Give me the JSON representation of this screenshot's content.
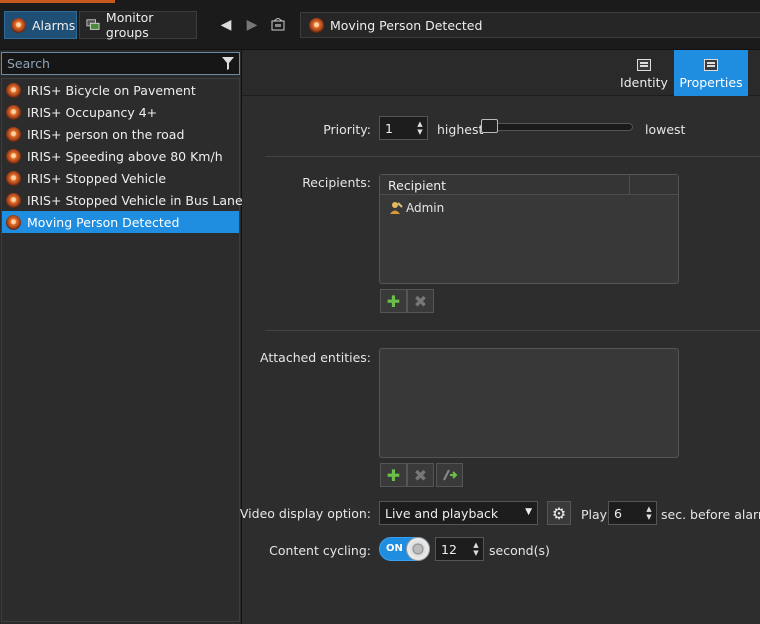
{
  "header": {
    "tabs": [
      {
        "label": "Alarms",
        "icon": "alarm-icon",
        "active": true
      },
      {
        "label": "Monitor groups",
        "icon": "monitor-groups-icon",
        "active": false
      }
    ],
    "title": "Moving Person Detected"
  },
  "search": {
    "placeholder": "Search"
  },
  "alarms": [
    {
      "label": "IRIS+ Bicycle on Pavement"
    },
    {
      "label": "IRIS+ Occupancy 4+"
    },
    {
      "label": "IRIS+ person on the road"
    },
    {
      "label": "IRIS+ Speeding above 80 Km/h"
    },
    {
      "label": "IRIS+ Stopped Vehicle"
    },
    {
      "label": "IRIS+ Stopped Vehicle in Bus Lane"
    },
    {
      "label": "Moving Person Detected",
      "selected": true
    }
  ],
  "right_tabs": [
    {
      "label": "Identity",
      "active": false
    },
    {
      "label": "Properties",
      "active": true
    }
  ],
  "priority": {
    "label": "Priority:",
    "value": "1",
    "highest": "highest",
    "lowest": "lowest",
    "slider_level": 0.0
  },
  "recipients": {
    "label": "Recipients:",
    "column": "Recipient",
    "items": [
      {
        "name": "Admin"
      }
    ]
  },
  "attached": {
    "label": "Attached entities:"
  },
  "video": {
    "label": "Video display option:",
    "value": "Live and playback",
    "play_label": "Play",
    "play_value": "6",
    "suffix": "sec. before alarm"
  },
  "cycling": {
    "label": "Content cycling:",
    "toggle_label": "ON",
    "value": "12",
    "suffix": "second(s)"
  },
  "colors": {
    "accent": "#1f8de0",
    "tab_active": "#1f4f74",
    "brand_orange": "#c65a1e"
  }
}
